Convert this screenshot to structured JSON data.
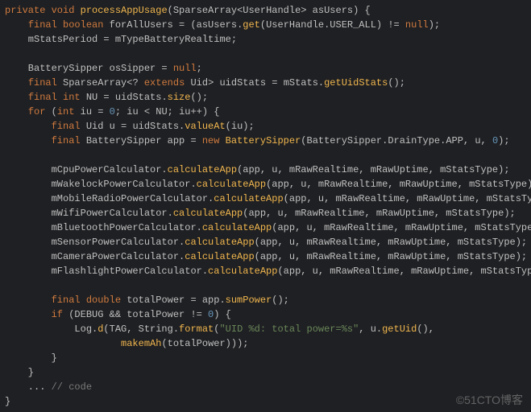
{
  "code": {
    "lines": [
      {
        "t": "private void ",
        "c": "kw",
        "s": [
          {
            "t": "private ",
            "c": "kw"
          },
          {
            "t": "void ",
            "c": "kw"
          },
          {
            "t": "processAppUsage",
            "c": "fn"
          },
          {
            "t": "(SparseArray<UserHandle> asUsers) {",
            "c": "ident"
          }
        ]
      },
      {
        "s": [
          {
            "t": "    ",
            "c": "ident"
          },
          {
            "t": "final boolean ",
            "c": "kw"
          },
          {
            "t": "forAllUsers = (asUsers.",
            "c": "ident"
          },
          {
            "t": "get",
            "c": "call"
          },
          {
            "t": "(UserHandle.USER_ALL) != ",
            "c": "ident"
          },
          {
            "t": "null",
            "c": "kw"
          },
          {
            "t": ");",
            "c": "ident"
          }
        ]
      },
      {
        "s": [
          {
            "t": "    mStatsPeriod = mTypeBatteryRealtime;",
            "c": "ident"
          }
        ]
      },
      {
        "s": [
          {
            "t": "",
            "c": "ident"
          }
        ]
      },
      {
        "s": [
          {
            "t": "    BatterySipper osSipper = ",
            "c": "ident"
          },
          {
            "t": "null",
            "c": "kw"
          },
          {
            "t": ";",
            "c": "ident"
          }
        ]
      },
      {
        "s": [
          {
            "t": "    ",
            "c": "ident"
          },
          {
            "t": "final ",
            "c": "kw"
          },
          {
            "t": "SparseArray<? ",
            "c": "ident"
          },
          {
            "t": "extends ",
            "c": "kw"
          },
          {
            "t": "Uid> uidStats = mStats.",
            "c": "ident"
          },
          {
            "t": "getUidStats",
            "c": "call"
          },
          {
            "t": "();",
            "c": "ident"
          }
        ]
      },
      {
        "s": [
          {
            "t": "    ",
            "c": "ident"
          },
          {
            "t": "final int ",
            "c": "kw"
          },
          {
            "t": "NU = uidStats.",
            "c": "ident"
          },
          {
            "t": "size",
            "c": "call"
          },
          {
            "t": "();",
            "c": "ident"
          }
        ]
      },
      {
        "s": [
          {
            "t": "    ",
            "c": "ident"
          },
          {
            "t": "for ",
            "c": "kw"
          },
          {
            "t": "(",
            "c": "ident"
          },
          {
            "t": "int ",
            "c": "kw"
          },
          {
            "t": "iu = ",
            "c": "ident"
          },
          {
            "t": "0",
            "c": "num"
          },
          {
            "t": "; iu < NU; iu++) {",
            "c": "ident"
          }
        ]
      },
      {
        "s": [
          {
            "t": "        ",
            "c": "ident"
          },
          {
            "t": "final ",
            "c": "kw"
          },
          {
            "t": "Uid u = uidStats.",
            "c": "ident"
          },
          {
            "t": "valueAt",
            "c": "call"
          },
          {
            "t": "(iu);",
            "c": "ident"
          }
        ]
      },
      {
        "s": [
          {
            "t": "        ",
            "c": "ident"
          },
          {
            "t": "final ",
            "c": "kw"
          },
          {
            "t": "BatterySipper app = ",
            "c": "ident"
          },
          {
            "t": "new ",
            "c": "kw"
          },
          {
            "t": "BatterySipper",
            "c": "call"
          },
          {
            "t": "(BatterySipper.DrainType.APP, u, ",
            "c": "ident"
          },
          {
            "t": "0",
            "c": "num"
          },
          {
            "t": ");",
            "c": "ident"
          }
        ]
      },
      {
        "s": [
          {
            "t": "",
            "c": "ident"
          }
        ]
      },
      {
        "s": [
          {
            "t": "        mCpuPowerCalculator.",
            "c": "ident"
          },
          {
            "t": "calculateApp",
            "c": "call"
          },
          {
            "t": "(app, u, mRawRealtime, mRawUptime, mStatsType);",
            "c": "ident"
          }
        ]
      },
      {
        "s": [
          {
            "t": "        mWakelockPowerCalculator.",
            "c": "ident"
          },
          {
            "t": "calculateApp",
            "c": "call"
          },
          {
            "t": "(app, u, mRawRealtime, mRawUptime, mStatsType);",
            "c": "ident"
          }
        ]
      },
      {
        "s": [
          {
            "t": "        mMobileRadioPowerCalculator.",
            "c": "ident"
          },
          {
            "t": "calculateApp",
            "c": "call"
          },
          {
            "t": "(app, u, mRawRealtime, mRawUptime, mStatsType);",
            "c": "ident"
          }
        ]
      },
      {
        "s": [
          {
            "t": "        mWifiPowerCalculator.",
            "c": "ident"
          },
          {
            "t": "calculateApp",
            "c": "call"
          },
          {
            "t": "(app, u, mRawRealtime, mRawUptime, mStatsType);",
            "c": "ident"
          }
        ]
      },
      {
        "s": [
          {
            "t": "        mBluetoothPowerCalculator.",
            "c": "ident"
          },
          {
            "t": "calculateApp",
            "c": "call"
          },
          {
            "t": "(app, u, mRawRealtime, mRawUptime, mStatsType);",
            "c": "ident"
          }
        ]
      },
      {
        "s": [
          {
            "t": "        mSensorPowerCalculator.",
            "c": "ident"
          },
          {
            "t": "calculateApp",
            "c": "call"
          },
          {
            "t": "(app, u, mRawRealtime, mRawUptime, mStatsType);",
            "c": "ident"
          }
        ]
      },
      {
        "s": [
          {
            "t": "        mCameraPowerCalculator.",
            "c": "ident"
          },
          {
            "t": "calculateApp",
            "c": "call"
          },
          {
            "t": "(app, u, mRawRealtime, mRawUptime, mStatsType);",
            "c": "ident"
          }
        ]
      },
      {
        "s": [
          {
            "t": "        mFlashlightPowerCalculator.",
            "c": "ident"
          },
          {
            "t": "calculateApp",
            "c": "call"
          },
          {
            "t": "(app, u, mRawRealtime, mRawUptime, mStatsType);",
            "c": "ident"
          }
        ]
      },
      {
        "s": [
          {
            "t": "",
            "c": "ident"
          }
        ]
      },
      {
        "s": [
          {
            "t": "        ",
            "c": "ident"
          },
          {
            "t": "final double ",
            "c": "kw"
          },
          {
            "t": "totalPower = app.",
            "c": "ident"
          },
          {
            "t": "sumPower",
            "c": "call"
          },
          {
            "t": "();",
            "c": "ident"
          }
        ]
      },
      {
        "s": [
          {
            "t": "        ",
            "c": "ident"
          },
          {
            "t": "if ",
            "c": "kw"
          },
          {
            "t": "(DEBUG && totalPower != ",
            "c": "ident"
          },
          {
            "t": "0",
            "c": "num"
          },
          {
            "t": ") {",
            "c": "ident"
          }
        ]
      },
      {
        "s": [
          {
            "t": "            Log.",
            "c": "ident"
          },
          {
            "t": "d",
            "c": "call"
          },
          {
            "t": "(TAG, String.",
            "c": "ident"
          },
          {
            "t": "format",
            "c": "call"
          },
          {
            "t": "(",
            "c": "ident"
          },
          {
            "t": "\"UID %d: total power=%s\"",
            "c": "str"
          },
          {
            "t": ", u.",
            "c": "ident"
          },
          {
            "t": "getUid",
            "c": "call"
          },
          {
            "t": "(),",
            "c": "ident"
          }
        ]
      },
      {
        "s": [
          {
            "t": "                    ",
            "c": "ident"
          },
          {
            "t": "makemAh",
            "c": "call"
          },
          {
            "t": "(totalPower)));",
            "c": "ident"
          }
        ]
      },
      {
        "s": [
          {
            "t": "        }",
            "c": "ident"
          }
        ]
      },
      {
        "s": [
          {
            "t": "    }",
            "c": "ident"
          }
        ]
      },
      {
        "s": [
          {
            "t": "    ... ",
            "c": "ident"
          },
          {
            "t": "// code",
            "c": "cmt"
          }
        ]
      },
      {
        "s": [
          {
            "t": "}",
            "c": "ident"
          }
        ]
      }
    ]
  },
  "watermark": "©51CTO博客"
}
